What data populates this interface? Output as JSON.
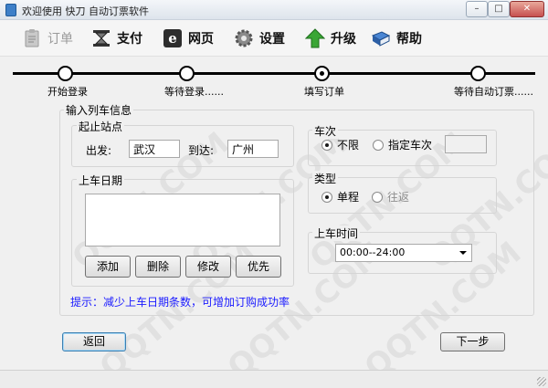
{
  "window": {
    "title": "欢迎使用 快刀 自动订票软件",
    "min_glyph": "–",
    "max_glyph": "□",
    "close_glyph": "✕"
  },
  "toolbar": {
    "items": [
      {
        "label": "订单",
        "icon": "clipboard-icon",
        "enabled": false
      },
      {
        "label": "支付",
        "icon": "hourglass-icon",
        "enabled": true
      },
      {
        "label": "网页",
        "icon": "browser-icon",
        "enabled": true
      },
      {
        "label": "设置",
        "icon": "gear-icon",
        "enabled": true
      },
      {
        "label": "升级",
        "icon": "up-arrow-icon",
        "enabled": true
      },
      {
        "label": "帮助",
        "icon": "book-icon",
        "enabled": true
      }
    ]
  },
  "steps": [
    {
      "label": "开始登录",
      "state": "done"
    },
    {
      "label": "等待登录......",
      "state": "done"
    },
    {
      "label": "填写订单",
      "state": "current"
    },
    {
      "label": "等待自动订票......",
      "state": "pending"
    }
  ],
  "form": {
    "group_title": "输入列车信息",
    "stations": {
      "title": "起止站点",
      "from_label": "出发:",
      "from_value": "武汉",
      "to_label": "到达:",
      "to_value": "广州"
    },
    "dates": {
      "title": "上车日期",
      "items": [],
      "add_label": "添加",
      "delete_label": "删除",
      "edit_label": "修改",
      "priority_label": "优先"
    },
    "train_no": {
      "title": "车次",
      "any_label": "不限",
      "specific_label": "指定车次",
      "selected": "any",
      "value": ""
    },
    "type": {
      "title": "类型",
      "oneway_label": "单程",
      "return_label": "往返",
      "selected": "oneway",
      "return_enabled": false
    },
    "time": {
      "title": "上车时间",
      "value": "00:00--24:00"
    },
    "tip": "提示：减少上车日期条数，可增加订购成功率"
  },
  "footer": {
    "back_label": "返回",
    "next_label": "下一步"
  },
  "watermark_text": "QQTN.COM",
  "colors": {
    "tip": "#1a1aff",
    "disabled_text": "#9a9a9a"
  }
}
